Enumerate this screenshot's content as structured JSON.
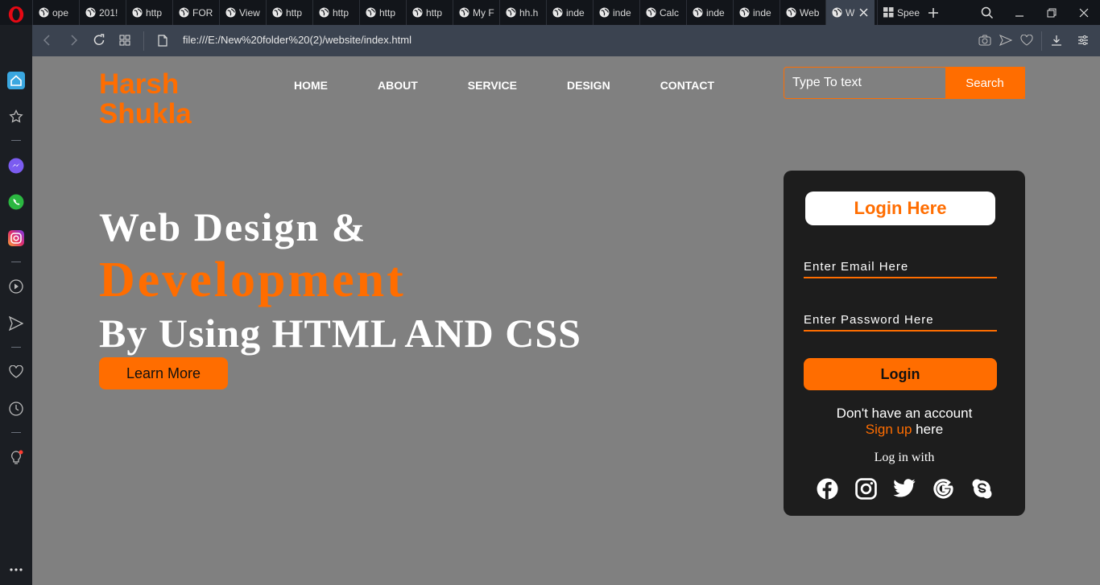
{
  "browser": {
    "tabs": [
      {
        "label": "ope",
        "icon": "opera-icon"
      },
      {
        "label": "201!",
        "icon": "globe-icon"
      },
      {
        "label": "http",
        "icon": "globe-icon"
      },
      {
        "label": "FOR",
        "icon": "globe-icon"
      },
      {
        "label": "View",
        "icon": "globe-icon"
      },
      {
        "label": "http",
        "icon": "globe-icon"
      },
      {
        "label": "http",
        "icon": "globe-icon"
      },
      {
        "label": "http",
        "icon": "globe-icon"
      },
      {
        "label": "http",
        "icon": "globe-icon"
      },
      {
        "label": "My F",
        "icon": "globe-icon"
      },
      {
        "label": "hh.h",
        "icon": "globe-icon"
      },
      {
        "label": "inde",
        "icon": "globe-icon"
      },
      {
        "label": "inde",
        "icon": "globe-icon"
      },
      {
        "label": "Calc",
        "icon": "globe-icon"
      },
      {
        "label": "inde",
        "icon": "globe-icon"
      },
      {
        "label": "inde",
        "icon": "globe-icon"
      },
      {
        "label": "Web",
        "icon": "globe-icon"
      },
      {
        "label": "W",
        "icon": "globe-icon",
        "active": true
      },
      {
        "label": "Spee",
        "icon": "speed-dial-icon"
      }
    ],
    "url": "file:///E:/New%20folder%20(2)/website/index.html"
  },
  "site": {
    "logo_line1": "Harsh",
    "logo_line2": "Shukla",
    "nav": [
      "HOME",
      "ABOUT",
      "SERVICE",
      "DESIGN",
      "CONTACT"
    ],
    "search": {
      "placeholder": "Type To text",
      "button": "Search"
    },
    "hero": {
      "line1": "Web Design &",
      "line2": "Development",
      "line3": "By Using HTML AND CSS",
      "cta": "Learn More"
    },
    "login": {
      "title": "Login Here",
      "email_placeholder": "Enter Email Here",
      "password_placeholder": "Enter Password Here",
      "button": "Login",
      "no_account": "Don't have an account",
      "signup_link": "Sign up",
      "signup_suffix": " here",
      "login_with": "Log in with",
      "socials": [
        "facebook-icon",
        "instagram-icon",
        "twitter-icon",
        "google-icon",
        "skype-icon"
      ]
    }
  },
  "colors": {
    "accent": "#ff6d00",
    "page_bg": "#808080",
    "card_bg": "#1d1d1d"
  }
}
